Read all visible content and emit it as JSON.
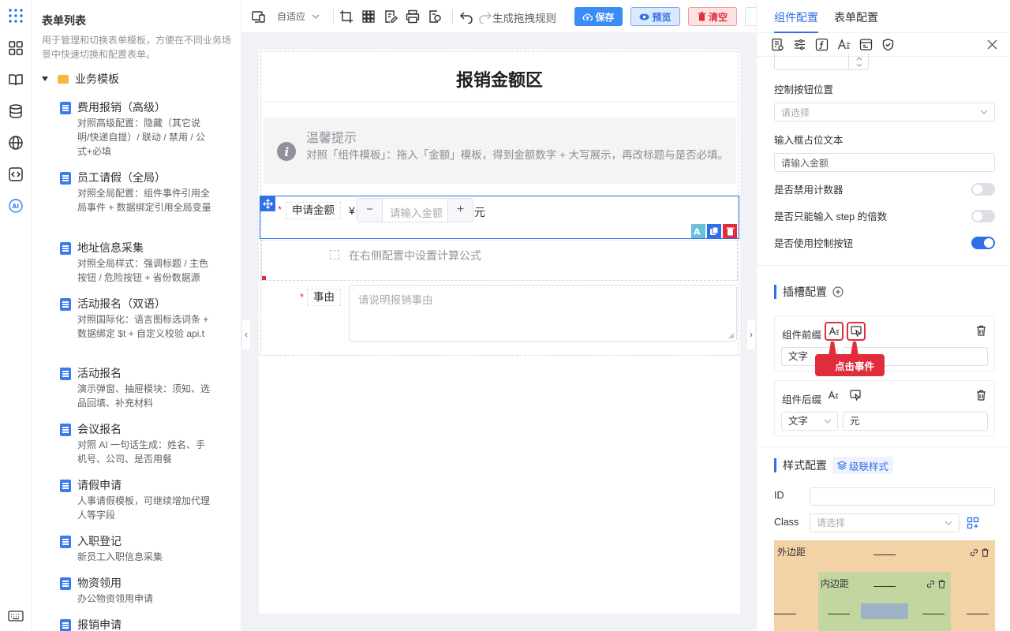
{
  "list_panel": {
    "title": "表单列表",
    "description": "用于管理和切换表单模板，方便在不同业务场景中快速切换和配置表单。",
    "folder": "业务模板",
    "items": [
      {
        "name": "费用报销（高级）",
        "desc": "对照高级配置：隐藏（其它说明/快递自提）/ 联动 / 禁用 / 公式+必填"
      },
      {
        "name": "员工请假（全局）",
        "desc": "对照全局配置：组件事件引用全局事件 + 数据绑定引用全局变量"
      },
      {
        "name": "地址信息采集",
        "desc": "对照全局样式：强调标题 / 主色按钮 / 危险按钮 + 省份数据源"
      },
      {
        "name": "活动报名（双语）",
        "desc": "对照国际化：语言图标选词条 + 数据绑定 $t + 自定义校验 api.t"
      },
      {
        "name": "活动报名",
        "desc": "演示弹窗、抽屉模块：须知、选品回填、补充材料"
      },
      {
        "name": "会议报名",
        "desc": "对照 AI 一句话生成：姓名、手机号、公司、是否用餐"
      },
      {
        "name": "请假申请",
        "desc": "人事请假模板，可继续增加代理人等字段"
      },
      {
        "name": "入职登记",
        "desc": "新员工入职信息采集"
      },
      {
        "name": "物资领用",
        "desc": "办公物资领用申请"
      },
      {
        "name": "报销申请",
        "desc": ""
      }
    ]
  },
  "toolbar": {
    "adapt": "自适应",
    "gen_rule": "生成拖拽规则",
    "save": "保存",
    "preview": "预览",
    "clear": "清空"
  },
  "canvas": {
    "section_title": "报销金额区",
    "tip_title": "温馨提示",
    "tip_body": "对照「组件模板」：拖入「金额」模板，得到金额数字 + 大写展示，再改标题与是否必填。",
    "amount_label": "申请金额",
    "currency": "¥",
    "minus": "−",
    "plus": "+",
    "amount_placeholder": "请输入金额",
    "unit": "元",
    "formula_hint": "在右侧配置中设置计算公式",
    "reason_label": "事由",
    "reason_placeholder": "请说明报销事由",
    "required_mark": "*"
  },
  "panel": {
    "tabs": [
      "组件配置",
      "表单配置"
    ],
    "control_pos_label": "控制按钮位置",
    "control_pos_placeholder": "请选择",
    "placeholder_label": "输入框占位文本",
    "placeholder_value": "请输入金额",
    "disable_counter_label": "是否禁用计数器",
    "step_only_label": "是否只能输入 step 的倍数",
    "use_controls_label": "是否使用控制按钮",
    "switches": {
      "disable_counter": false,
      "step_only": false,
      "use_controls": true
    },
    "slot_title": "插槽配置",
    "prefix_label": "组件前缀",
    "prefix_type": "文字",
    "tooltip": "点击事件",
    "suffix_label": "组件后缀",
    "suffix_type": "文字",
    "suffix_value": "元",
    "style_title": "样式配置",
    "cascade_style": "级联样式",
    "id_label": "ID",
    "class_label": "Class",
    "class_placeholder": "请选择",
    "margin_label": "外边距",
    "padding_label": "内边距"
  },
  "colors": {
    "primary": "#2f6fe8",
    "danger": "#e02d3c",
    "margin_box": "#f3d2a6",
    "padding_box": "#c3d69f",
    "content_box": "#9db4c8"
  }
}
